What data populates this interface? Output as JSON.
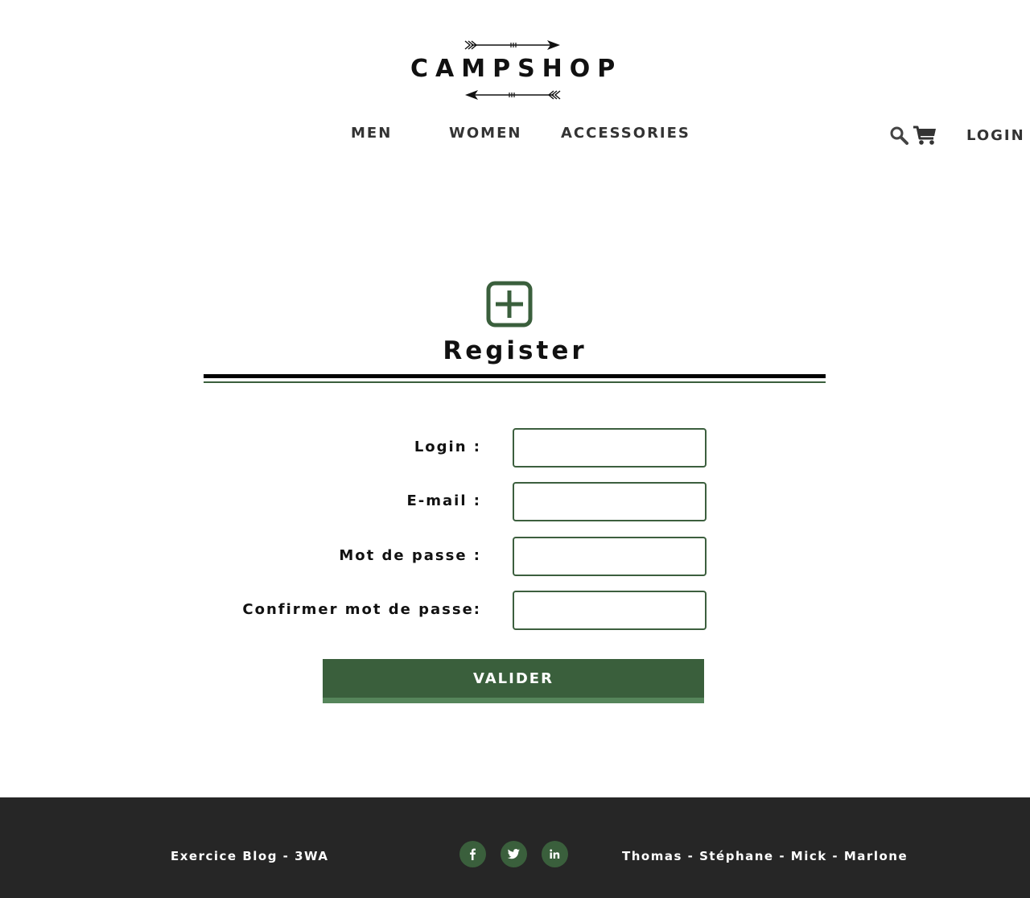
{
  "header": {
    "logo_text": "CAMPSHOP",
    "nav": [
      "MEN",
      "WOMEN",
      "ACCESSORIES"
    ],
    "search_icon": "search-icon",
    "cart_icon": "cart-icon",
    "login_label": "LOGIN"
  },
  "register": {
    "icon": "plus-square-icon",
    "title": "Register",
    "fields": [
      {
        "label": "Login :",
        "value": "",
        "placeholder": ""
      },
      {
        "label": "E-mail :",
        "value": "",
        "placeholder": ""
      },
      {
        "label": "Mot de passe :",
        "value": "",
        "placeholder": ""
      },
      {
        "label": "Confirmer mot de passe:",
        "value": "",
        "placeholder": ""
      }
    ],
    "submit_label": "VALIDER"
  },
  "footer": {
    "left_text": "Exercice Blog - 3WA",
    "right_text": "Thomas - Stéphane - Mick - Marlone",
    "social": [
      "facebook-icon",
      "twitter-icon",
      "linkedin-icon"
    ]
  },
  "colors": {
    "accent_green": "#3a5f3c",
    "accent_green_light": "#55855a",
    "footer_bg": "#262626",
    "text_dark": "#111111"
  }
}
